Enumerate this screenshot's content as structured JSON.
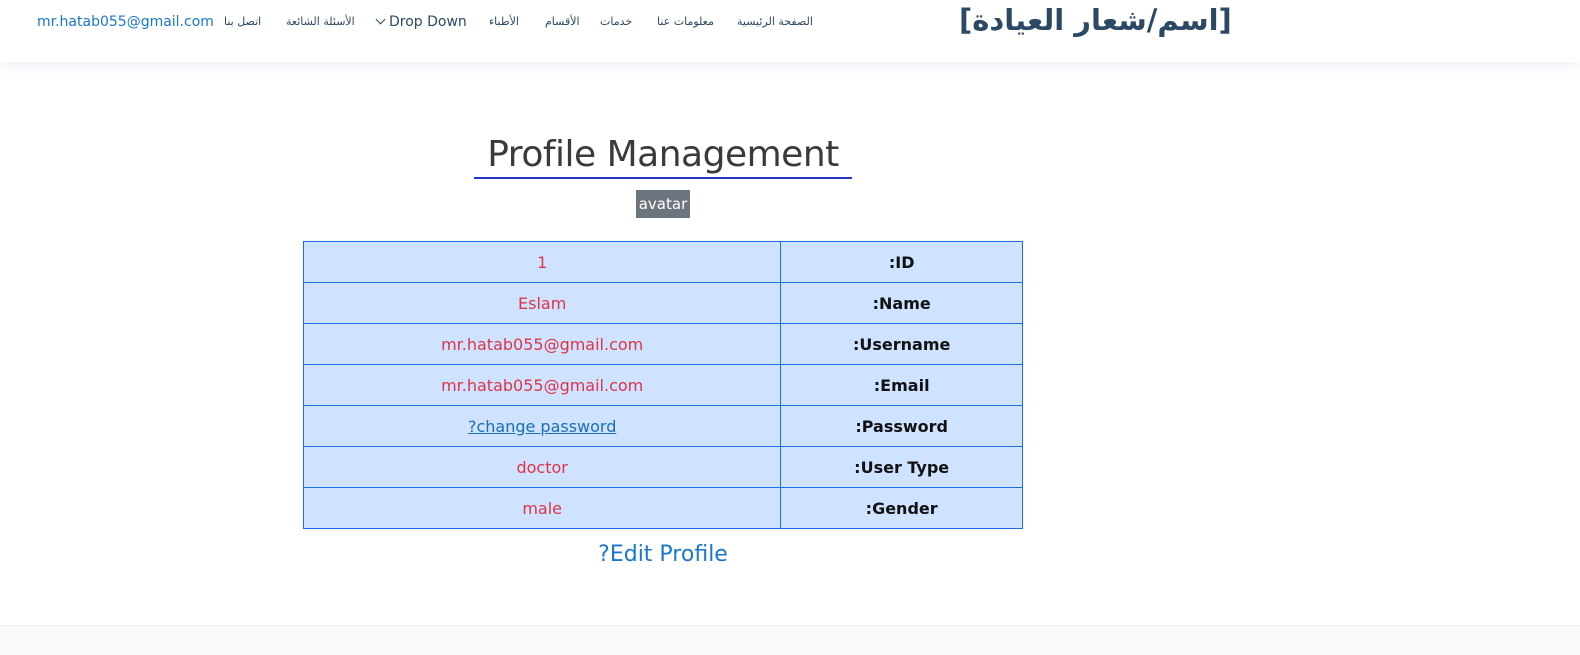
{
  "header": {
    "logo": "[اسم/شعار العيادة]",
    "nav": {
      "home": "الصفحة الرئيسية",
      "about": "معلومات عنا",
      "services": "خدمات",
      "departments": "الأقسام",
      "doctors": "الأطباء",
      "dropdown": "Drop Down",
      "faq": "الأسئلة الشائعة",
      "contact": "اتصل بنا",
      "email": "mr.hatab055@gmail.com"
    }
  },
  "main": {
    "title": "Profile Management",
    "avatar_alt": "avatar",
    "profile_rows": [
      {
        "label": ":ID",
        "value": "1"
      },
      {
        "label": ":Name",
        "value": "Eslam"
      },
      {
        "label": ":Username",
        "value": "mr.hatab055@gmail.com"
      },
      {
        "label": ":Email",
        "value": "mr.hatab055@gmail.com"
      },
      {
        "label": ":Password",
        "value": "?change password"
      },
      {
        "label": ":User Type",
        "value": "doctor"
      },
      {
        "label": ":Gender",
        "value": "male"
      }
    ],
    "edit_link": "?Edit Profile"
  },
  "colors": {
    "accent": "#1977cc",
    "brand_text": "#2c4964",
    "value_red": "#dc3545",
    "table_bg": "#cfe2ff",
    "table_border": "#1a6fe0",
    "badge_gray": "#6c757d"
  }
}
